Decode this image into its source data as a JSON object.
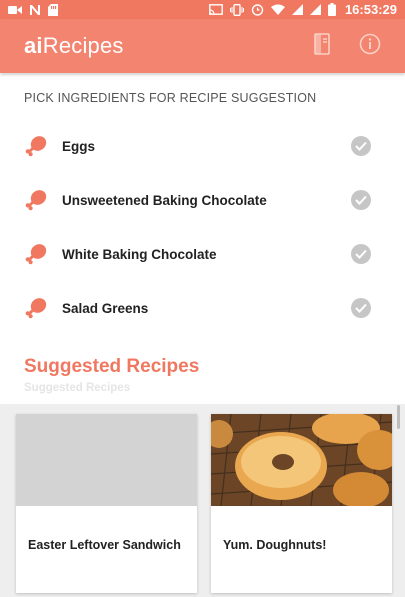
{
  "status_bar": {
    "time": "16:53:29"
  },
  "app_bar": {
    "logo_prefix": "ai",
    "logo_suffix": "Recipes"
  },
  "ingredients_section": {
    "header": "PICK INGREDIENTS FOR RECIPE SUGGESTION",
    "items": [
      {
        "label": "Eggs"
      },
      {
        "label": "Unsweetened Baking Chocolate"
      },
      {
        "label": "White Baking Chocolate"
      },
      {
        "label": "Salad Greens"
      }
    ]
  },
  "suggested": {
    "title": "Suggested Recipes",
    "subtitle": "Suggested Recipes",
    "recipes": [
      {
        "title": "Easter Leftover Sandwich"
      },
      {
        "title": "Yum. Doughnuts!"
      }
    ]
  },
  "colors": {
    "accent": "#f07860",
    "appbar": "#f28470",
    "check": "#c6c6c6"
  }
}
